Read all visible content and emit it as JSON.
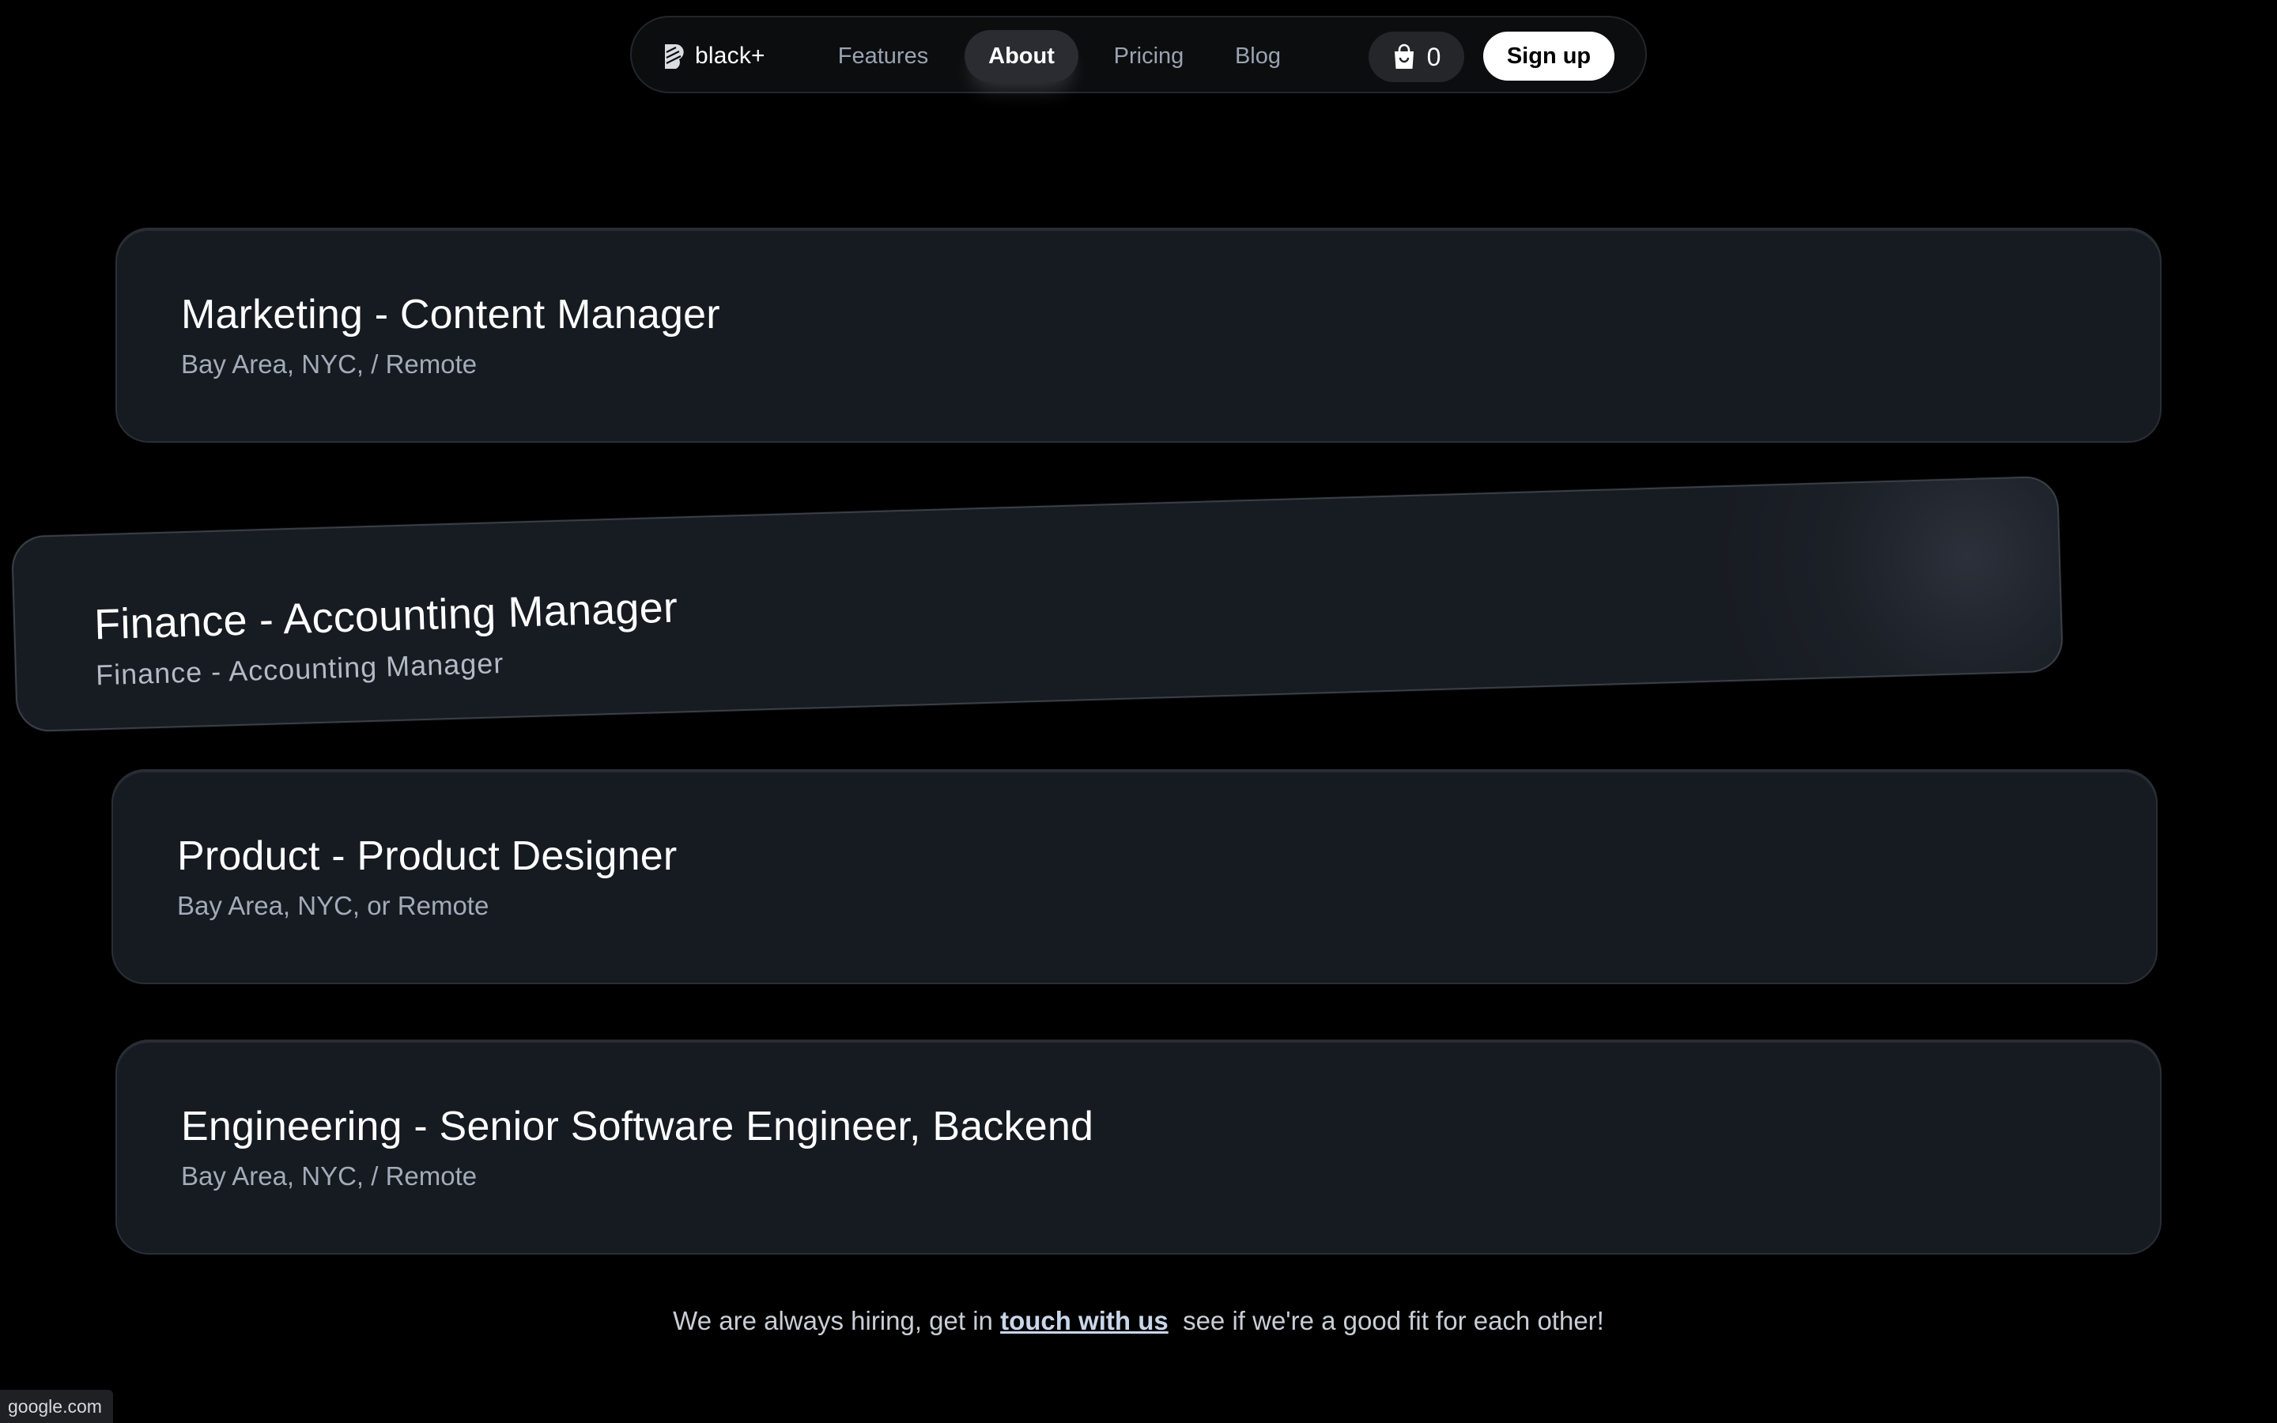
{
  "nav": {
    "brand": "black+",
    "links": [
      "Features",
      "About",
      "Pricing",
      "Blog"
    ],
    "active": "About",
    "cart_count": "0",
    "signup_label": "Sign up"
  },
  "jobs": [
    {
      "title": "Marketing - Content Manager",
      "location": "Bay Area, NYC, / Remote"
    },
    {
      "title": "Finance - Accounting Manager",
      "location": "Finance - Accounting Manager"
    },
    {
      "title": "Product - Product Designer",
      "location": "Bay Area, NYC, or Remote"
    },
    {
      "title": "Engineering - Senior Software Engineer, Backend",
      "location": "Bay Area, NYC, / Remote"
    }
  ],
  "footer": {
    "before": "We are always hiring, get in ",
    "link": "touch with us",
    "after": "  see if we're a good fit for each other!"
  },
  "status_url": "google.com",
  "colors": {
    "background": "#000000",
    "card": "#161a21",
    "muted_text": "#a3abb8"
  }
}
